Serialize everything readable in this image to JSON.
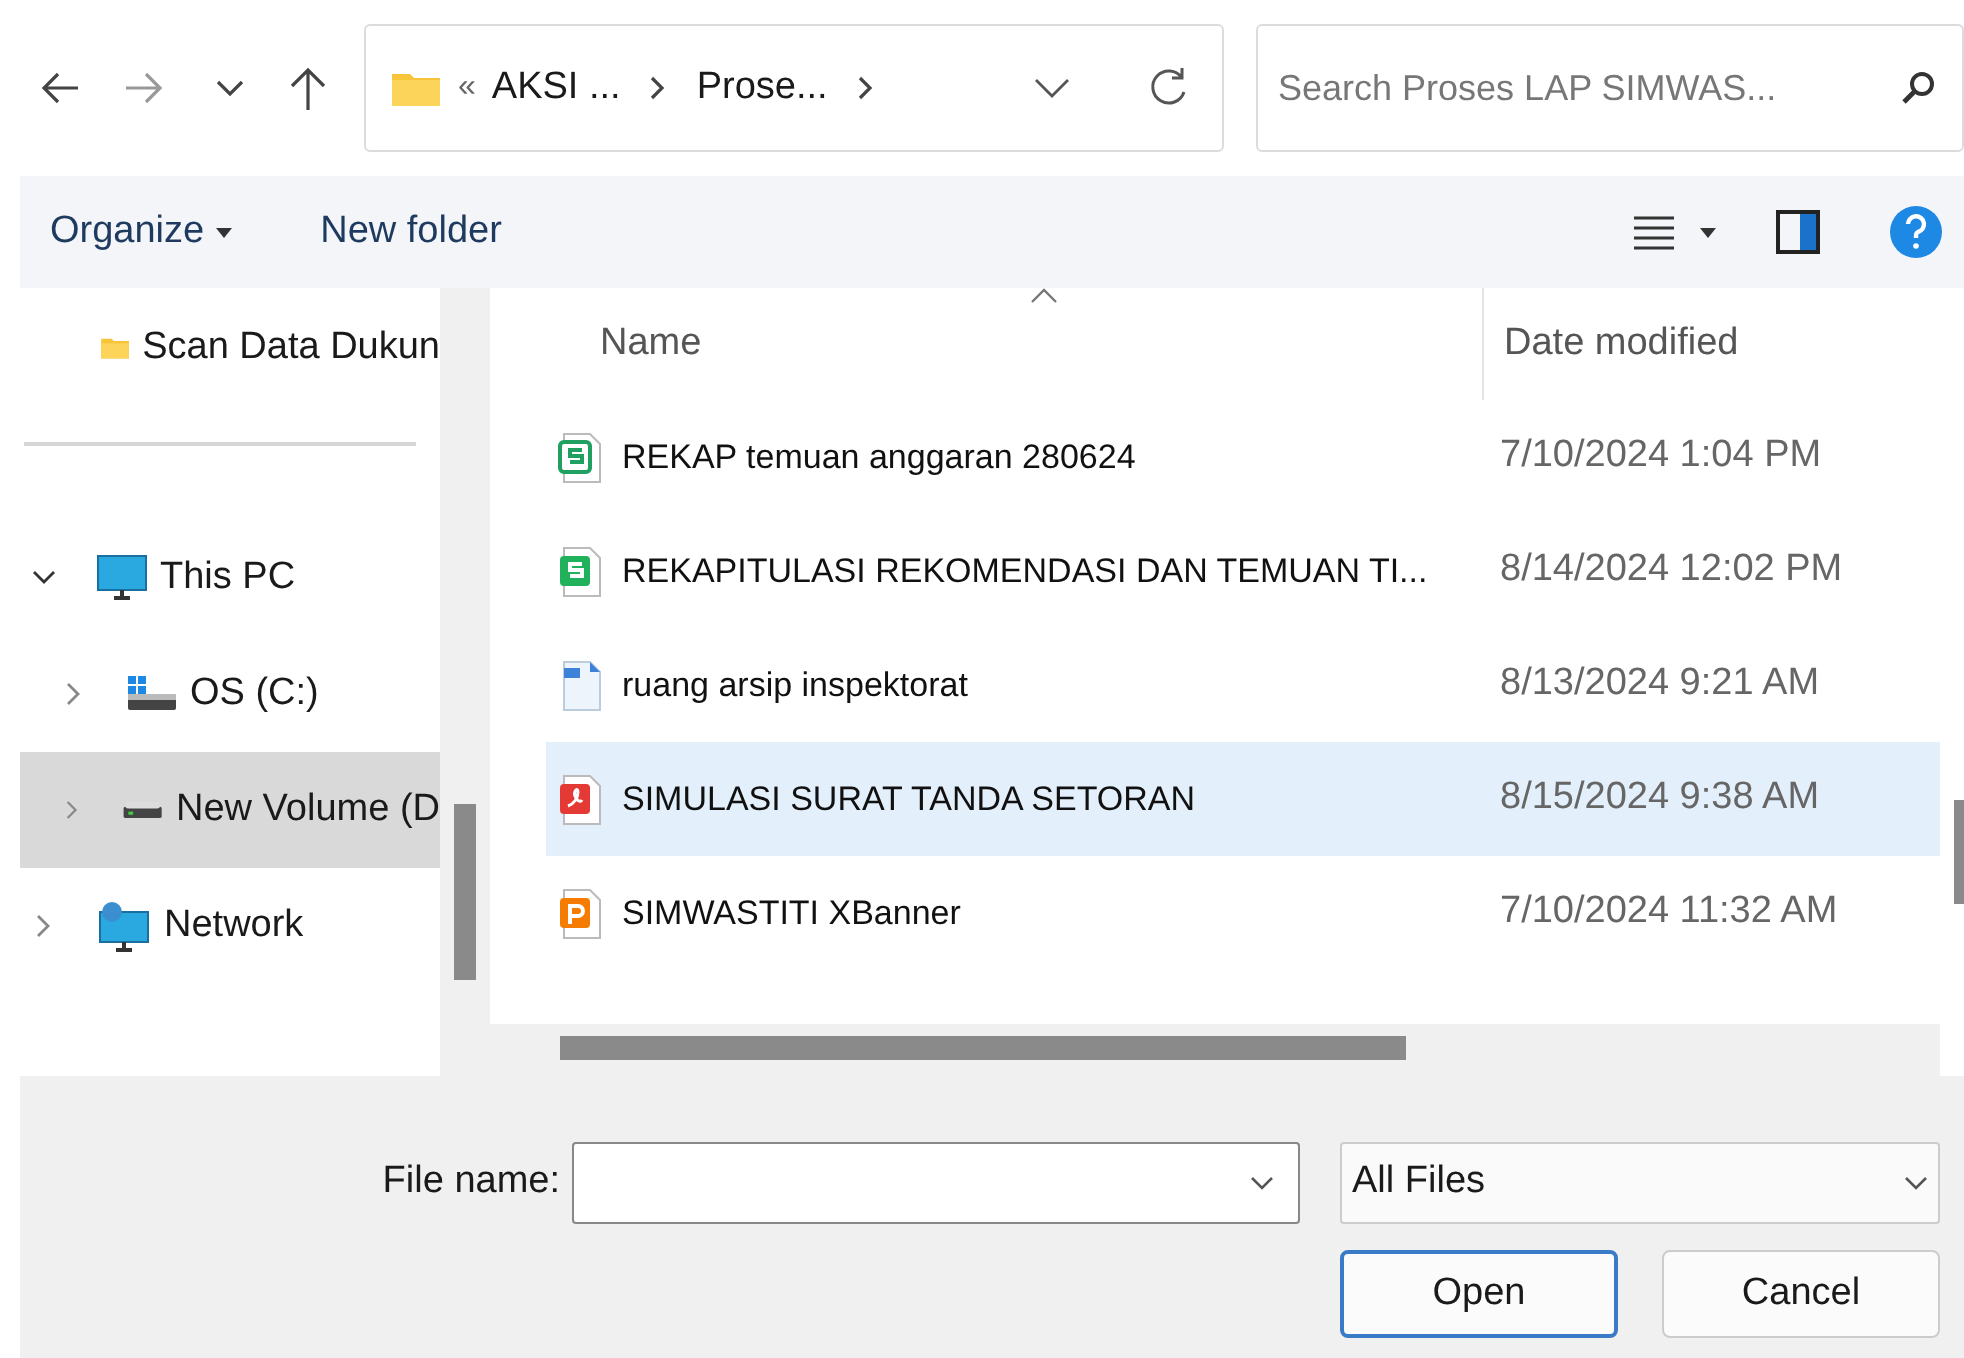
{
  "nav_bar": {
    "breadcrumb": [
      "AKSI ...",
      "Prose..."
    ],
    "overflow_mark": "«",
    "search": {
      "placeholder": "Search Proses LAP SIMWAS..."
    }
  },
  "toolbar": {
    "organize": "Organize",
    "new_folder": "New folder"
  },
  "sidebar": {
    "quick_access": [
      {
        "label": "Scan Data Dukun",
        "selected": false
      }
    ],
    "tree": [
      {
        "label": "This PC",
        "kind": "monitor",
        "expanded": true,
        "selected": false,
        "children": [
          {
            "label": "OS (C:)",
            "kind": "os-drive",
            "expanded": false,
            "selected": false
          },
          {
            "label": "New Volume (D",
            "kind": "drive",
            "expanded": false,
            "selected": true
          }
        ]
      },
      {
        "label": "Network",
        "kind": "network",
        "expanded": false,
        "selected": false
      }
    ]
  },
  "file_list": {
    "columns": [
      "Name",
      "Date modified"
    ],
    "rows": [
      {
        "name": "REKAP temuan anggaran 280624",
        "date": "7/10/2024 1:04 PM",
        "kind": "sheet-outline",
        "selected": false
      },
      {
        "name": "REKAPITULASI REKOMENDASI DAN TEMUAN TI...",
        "date": "8/14/2024 12:02 PM",
        "kind": "sheet",
        "selected": false
      },
      {
        "name": "ruang arsip inspektorat",
        "date": "8/13/2024 9:21 AM",
        "kind": "image",
        "selected": false
      },
      {
        "name": "SIMULASI SURAT TANDA SETORAN",
        "date": "8/15/2024 9:38 AM",
        "kind": "pdf",
        "selected": true
      },
      {
        "name": "SIMWASTITI XBanner",
        "date": "7/10/2024 11:32 AM",
        "kind": "slides",
        "selected": false
      }
    ]
  },
  "footer": {
    "file_name_label": "File name:",
    "file_type": "All Files",
    "buttons": [
      "Open",
      "Cancel"
    ]
  }
}
